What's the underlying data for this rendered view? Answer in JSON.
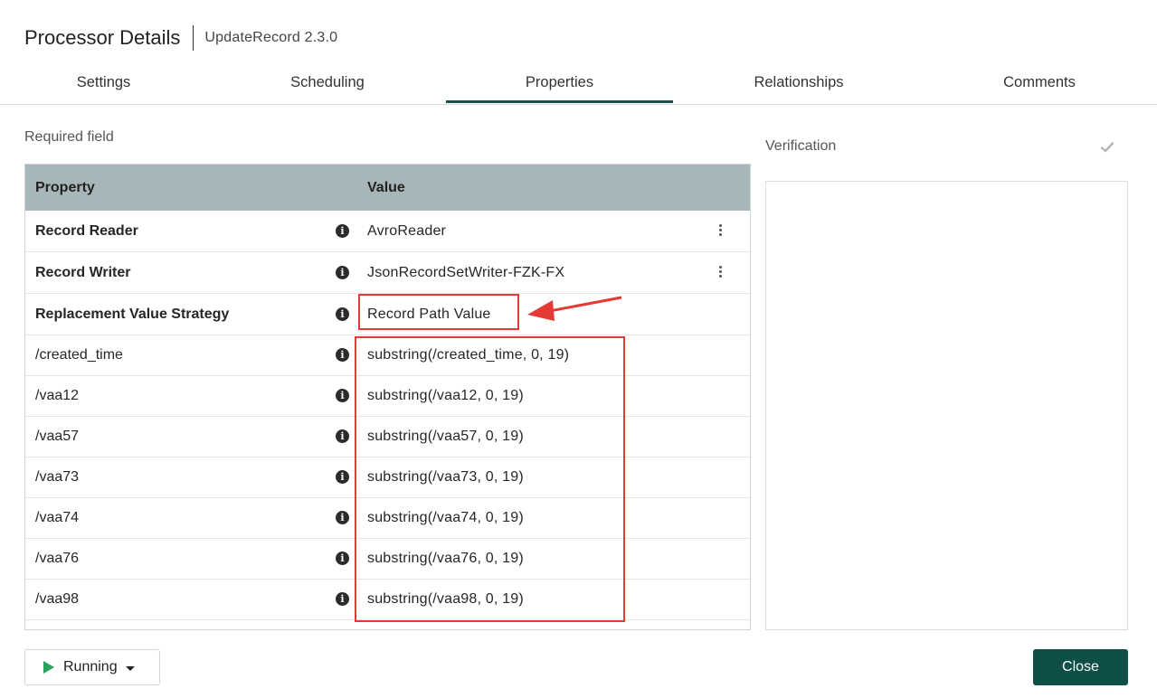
{
  "header": {
    "title": "Processor Details",
    "subtitle": "UpdateRecord 2.3.0"
  },
  "tabs": [
    {
      "label": "Settings",
      "active": false
    },
    {
      "label": "Scheduling",
      "active": false
    },
    {
      "label": "Properties",
      "active": true
    },
    {
      "label": "Relationships",
      "active": false
    },
    {
      "label": "Comments",
      "active": false
    }
  ],
  "properties": {
    "required_label": "Required field",
    "columns": {
      "property": "Property",
      "value": "Value"
    },
    "rows": [
      {
        "name": "Record Reader",
        "value": "AvroReader",
        "required": true,
        "has_menu": true
      },
      {
        "name": "Record Writer",
        "value": "JsonRecordSetWriter-FZK-FX",
        "required": true,
        "has_menu": true
      },
      {
        "name": "Replacement Value Strategy",
        "value": "Record Path Value",
        "required": true,
        "has_menu": false
      },
      {
        "name": "/created_time",
        "value": "substring(/created_time, 0, 19)",
        "required": false,
        "has_menu": false
      },
      {
        "name": "/vaa12",
        "value": "substring(/vaa12, 0, 19)",
        "required": false,
        "has_menu": false
      },
      {
        "name": "/vaa57",
        "value": "substring(/vaa57, 0, 19)",
        "required": false,
        "has_menu": false
      },
      {
        "name": "/vaa73",
        "value": "substring(/vaa73, 0, 19)",
        "required": false,
        "has_menu": false
      },
      {
        "name": "/vaa74",
        "value": "substring(/vaa74, 0, 19)",
        "required": false,
        "has_menu": false
      },
      {
        "name": "/vaa76",
        "value": "substring(/vaa76, 0, 19)",
        "required": false,
        "has_menu": false
      },
      {
        "name": "/vaa98",
        "value": "substring(/vaa98, 0, 19)",
        "required": false,
        "has_menu": false
      }
    ]
  },
  "verification": {
    "label": "Verification",
    "icon": "check-icon"
  },
  "footer": {
    "run_label": "Running",
    "close_label": "Close"
  },
  "colors": {
    "accent": "#0e4f47",
    "header_bg": "#a7b6b9",
    "annotation": "#e53935",
    "run": "#27a35a"
  }
}
